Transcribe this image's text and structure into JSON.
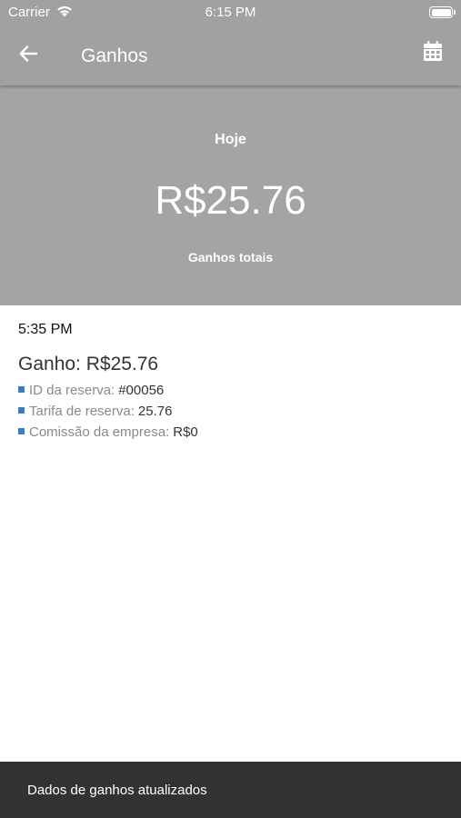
{
  "status_bar": {
    "carrier": "Carrier",
    "time": "6:15 PM"
  },
  "header": {
    "title": "Ganhos",
    "back_icon": "arrow-left-icon",
    "calendar_icon": "calendar-icon"
  },
  "summary": {
    "period": "Hoje",
    "amount": "R$25.76",
    "label": "Ganhos totais"
  },
  "entries": [
    {
      "time": "5:35 PM",
      "title": "Ganho: R$25.76",
      "details": [
        {
          "label": "ID da reserva:",
          "value": "#00056"
        },
        {
          "label": "Tarifa de reserva:",
          "value": "25.76"
        },
        {
          "label": "Comissão da empresa:",
          "value": "R$0"
        }
      ]
    }
  ],
  "snackbar": {
    "message": "Dados de ganhos atualizados"
  },
  "colors": {
    "header_bg": "#a1a1a1",
    "summary_bg": "#a4a4a4",
    "bullet": "#3b7dc4",
    "snackbar_bg": "#323232"
  }
}
